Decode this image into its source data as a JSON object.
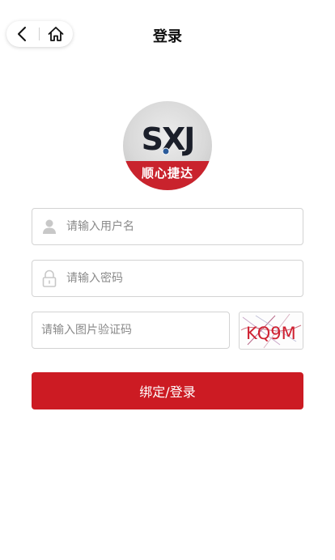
{
  "header": {
    "title": "登录"
  },
  "logo": {
    "brand_mark": "SXJ",
    "brand_name": "顺心捷达"
  },
  "form": {
    "username_placeholder": "请输入用户名",
    "password_placeholder": "请输入密码",
    "captcha_placeholder": "请输入图片验证码",
    "captcha_text": "KQ9M",
    "submit_label": "绑定/登录"
  },
  "colors": {
    "primary": "#cc1b23",
    "logo_band": "#c9232d",
    "border": "#d3d3d3",
    "placeholder": "#8a8a8a"
  },
  "icons": [
    "back-arrow-icon",
    "home-icon",
    "user-icon",
    "lock-icon"
  ]
}
